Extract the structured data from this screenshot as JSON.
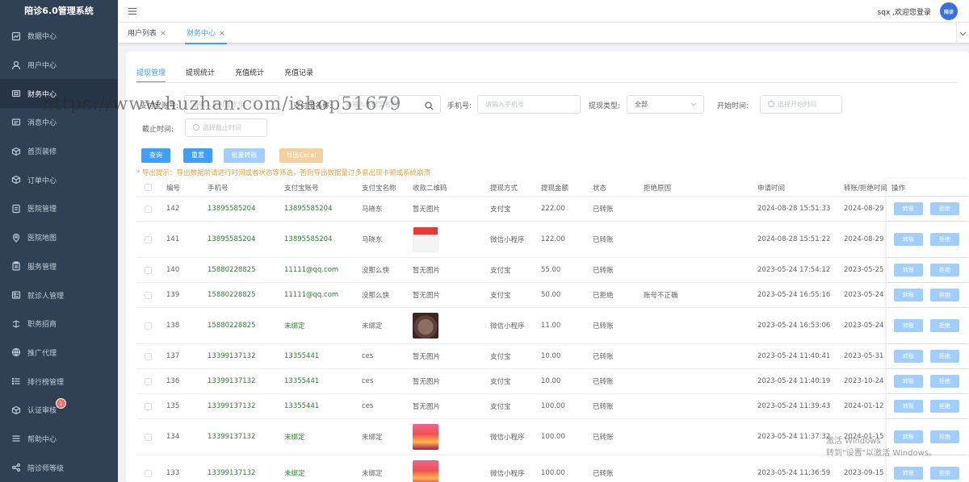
{
  "app": {
    "title": "陪诊6.0管理系统"
  },
  "sidebar": {
    "items": [
      {
        "label": "数据中心",
        "icon": "chart-icon"
      },
      {
        "label": "用户中心",
        "icon": "user-icon"
      },
      {
        "label": "财务中心",
        "icon": "wallet-icon",
        "active": true
      },
      {
        "label": "消息中心",
        "icon": "message-icon"
      },
      {
        "label": "首页装修",
        "icon": "box-icon"
      },
      {
        "label": "订单中心",
        "icon": "box-icon"
      },
      {
        "label": "医院管理",
        "icon": "document-icon"
      },
      {
        "label": "医院地图",
        "icon": "location-icon"
      },
      {
        "label": "服务管理",
        "icon": "clipboard-icon"
      },
      {
        "label": "就诊人管理",
        "icon": "patient-icon"
      },
      {
        "label": "职务招商",
        "icon": "briefcase-icon"
      },
      {
        "label": "推广代理",
        "icon": "globe-icon"
      },
      {
        "label": "排行榜管理",
        "icon": "list-icon"
      },
      {
        "label": "认证审核",
        "icon": "box-icon",
        "badge": "1"
      },
      {
        "label": "帮助中心",
        "icon": "menu-icon"
      },
      {
        "label": "陪诊师等级",
        "icon": "share-icon"
      }
    ]
  },
  "header": {
    "welcome": "sqx ,欢迎您登录",
    "avatar_text": "陪诊"
  },
  "tags": [
    {
      "label": "用户列表",
      "close": "×"
    },
    {
      "label": "财务中心",
      "close": "×",
      "active": true
    }
  ],
  "subtabs": [
    "提现管理",
    "提现统计",
    "充值统计",
    "充值记录"
  ],
  "form": {
    "alipay_account_label": "支付宝账号:",
    "alipay_account_placeholder": "请输入支付宝账号",
    "alipay_name_label": "支付宝名称:",
    "alipay_name_placeholder": "请输入支付宝名称",
    "phone_label": "手机号:",
    "phone_placeholder": "请输入手机号",
    "type_label": "提现类型:",
    "type_value": "全部",
    "start_label": "开始时间:",
    "start_placeholder": "选择开始时间",
    "end_label": "截止时间:",
    "end_placeholder": "选择截止时间"
  },
  "buttons": {
    "query": "查询",
    "reset": "重置",
    "batch": "批量转账",
    "export": "导出Excel"
  },
  "tip": "* 导出提示：导出数据前请进行时间或者状态等筛选，否则导出数据量过多易出现卡顿或系统崩溃",
  "table": {
    "columns": [
      "编号",
      "手机号",
      "支付宝账号",
      "支付宝名称",
      "收款二维码",
      "提现方式",
      "提现金额",
      "状态",
      "拒绝原因",
      "申请时间",
      "转账/拒绝时间",
      "操作"
    ],
    "transfer_label": "转账",
    "reject_label": "拒绝",
    "rows": [
      {
        "id": "142",
        "phone": "13895585204",
        "account": "13895585204",
        "name": "马晓东",
        "qr": "暂无图片",
        "method": "支付宝",
        "amount": "222.00",
        "status": "已转账",
        "reason": "",
        "apply": "2024-08-28 15:51:33",
        "done": "2024-08-29"
      },
      {
        "id": "141",
        "phone": "13895585204",
        "account": "13895585204",
        "name": "马晓东",
        "qr": "",
        "qr_img": "red",
        "method": "微信小程序",
        "amount": "122.00",
        "status": "已转账",
        "reason": "",
        "apply": "2024-08-28 15:51:22",
        "done": "2024-08-29"
      },
      {
        "id": "140",
        "phone": "15880228825",
        "account": "11111@qq.com",
        "name": "没那么快",
        "qr": "暂无图片",
        "method": "支付宝",
        "amount": "55.00",
        "status": "已转账",
        "reason": "",
        "apply": "2023-05-24 17:54:12",
        "done": "2023-05-25"
      },
      {
        "id": "139",
        "phone": "15880228825",
        "account": "11111@qq.com",
        "name": "没那么快",
        "qr": "暂无图片",
        "method": "支付宝",
        "amount": "50.00",
        "status": "已拒绝",
        "reason": "账号不正确",
        "apply": "2023-05-24 16:55:16",
        "done": "2023-05-24"
      },
      {
        "id": "138",
        "phone": "15880228825",
        "account": "未绑定",
        "name": "未绑定",
        "qr": "",
        "qr_img": "food",
        "method": "微信小程序",
        "amount": "11.00",
        "status": "已转账",
        "reason": "",
        "apply": "2023-05-24 16:53:06",
        "done": "2023-05-24"
      },
      {
        "id": "137",
        "phone": "13399137132",
        "account": "13355441",
        "name": "ces",
        "qr": "暂无图片",
        "method": "支付宝",
        "amount": "10.00",
        "status": "已转账",
        "reason": "",
        "apply": "2023-05-24 11:40:41",
        "done": "2023-05-31"
      },
      {
        "id": "136",
        "phone": "13399137132",
        "account": "13355441",
        "name": "ces",
        "qr": "暂无图片",
        "method": "支付宝",
        "amount": "10.00",
        "status": "已转账",
        "reason": "",
        "apply": "2023-05-24 11:40:19",
        "done": "2023-10-24"
      },
      {
        "id": "135",
        "phone": "13399137132",
        "account": "13355441",
        "name": "ces",
        "qr": "暂无图片",
        "method": "支付宝",
        "amount": "100.00",
        "status": "已转账",
        "reason": "",
        "apply": "2023-05-24 11:39:43",
        "done": "2024-01-12"
      },
      {
        "id": "134",
        "phone": "13399137132",
        "account": "未绑定",
        "name": "未绑定",
        "qr": "",
        "qr_img": "sunset",
        "method": "微信小程序",
        "amount": "100.00",
        "status": "已转账",
        "reason": "",
        "apply": "2023-05-24 11:37:32",
        "done": "2024-01-15"
      },
      {
        "id": "133",
        "phone": "13399137132",
        "account": "未绑定",
        "name": "未绑定",
        "qr": "",
        "qr_img": "sunset",
        "method": "微信小程序",
        "amount": "100.00",
        "status": "已转账",
        "reason": "",
        "apply": "2023-05-24 11:36:59",
        "done": "2023-09-15"
      }
    ]
  },
  "watermark": "https://www.huzhan.com/ishop51679",
  "windows_activation": {
    "line1": "激活 Windows",
    "line2": "转到\"设置\"以激活 Windows。"
  }
}
